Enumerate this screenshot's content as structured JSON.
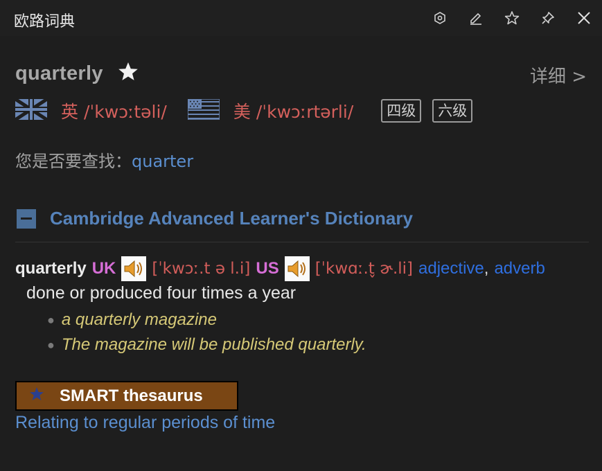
{
  "app": {
    "title": "欧路词典"
  },
  "titlebar": {
    "icons": [
      "settings-icon",
      "edit-icon",
      "star-icon",
      "pin-icon",
      "close-icon"
    ]
  },
  "word": {
    "headword": "quarterly",
    "detail_label": "详细 >"
  },
  "pronunciation": {
    "uk": {
      "label": "英",
      "ipa": "/ˈkwɔːtəli/"
    },
    "us": {
      "label": "美",
      "ipa": "/ˈkwɔːrtərli/"
    },
    "tags": [
      "四级",
      "六级"
    ]
  },
  "suggestion": {
    "prefix": "您是否要查找：",
    "word": "quarter"
  },
  "dictionary": {
    "name": "Cambridge Advanced Learner's Dictionary",
    "entry": {
      "headword": "quarterly",
      "uk_label": "UK",
      "uk_ipa": "[ˈkwɔː.t ə l.i]",
      "us_label": "US",
      "us_ipa": "[ˈkwɑː.t̬ ɚ.li]",
      "pos1": "adjective",
      "comma": ",",
      "pos2": "adverb",
      "definition": "done or produced four times a year",
      "examples": [
        "a quarterly magazine",
        "The magazine will be published quarterly."
      ]
    },
    "thesaurus": {
      "label": "SMART thesaurus",
      "link": "Relating to regular periods of time"
    }
  },
  "colors": {
    "background": "#1e1e1e",
    "headword": "#a8a8a8",
    "ipa": "#d4605c",
    "link": "#5b8fd0",
    "dict_title": "#5683bb",
    "example": "#d6c977",
    "thesaurus_bg": "#7a4614"
  }
}
